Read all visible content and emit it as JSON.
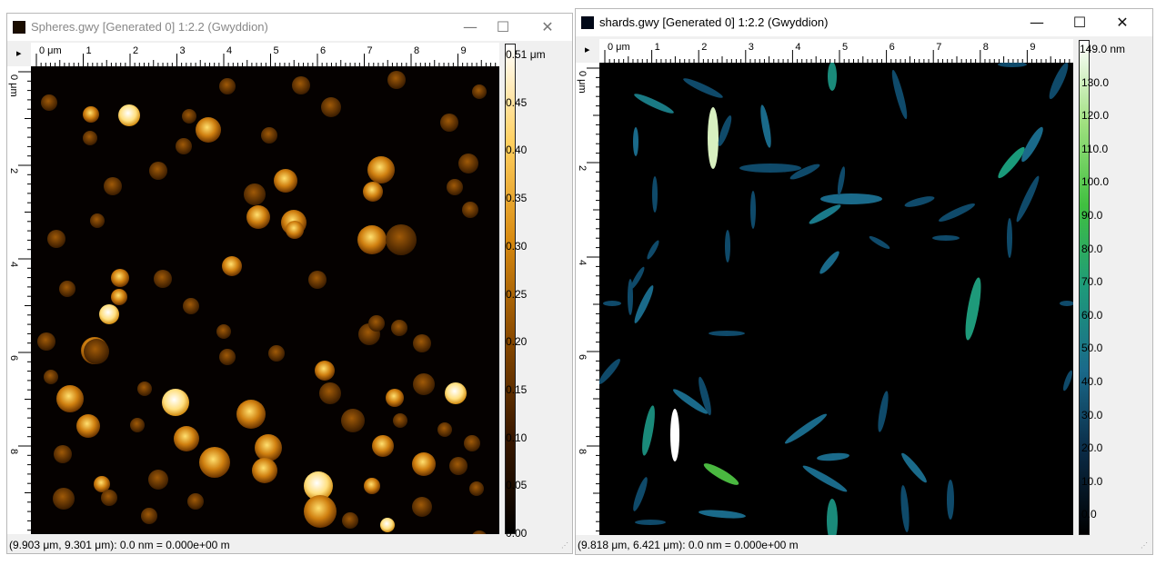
{
  "window1": {
    "title": "Spheres.gwy [Generated 0] 1:2.2 (Gwyddion)",
    "hruler_labels": [
      "0 μm",
      "1",
      "2",
      "3",
      "4",
      "5",
      "6",
      "7",
      "8",
      "9"
    ],
    "vruler_labels": [
      "0 μm",
      "2",
      "4",
      "6",
      "8"
    ],
    "colorbar": {
      "max_label": "0.51 μm",
      "ticks": [
        "0.45",
        "0.40",
        "0.35",
        "0.30",
        "0.25",
        "0.20",
        "0.15",
        "0.10",
        "0.05",
        "0.00"
      ],
      "gradient": [
        "#000000",
        "#3a1800",
        "#8a4a00",
        "#d88a10",
        "#ffd060",
        "#ffffff"
      ]
    },
    "status": "(9.903 μm, 9.301 μm): 0.0 nm = 0.000e+00 m"
  },
  "window2": {
    "title": "shards.gwy [Generated 0] 1:2.2 (Gwyddion)",
    "hruler_labels": [
      "0 μm",
      "1",
      "2",
      "3",
      "4",
      "5",
      "6",
      "7",
      "8",
      "9"
    ],
    "vruler_labels": [
      "0 μm",
      "2",
      "4",
      "6",
      "8"
    ],
    "colorbar": {
      "max_label": "149.0 nm",
      "ticks": [
        "130.0",
        "120.0",
        "110.0",
        "100.0",
        "90.0",
        "80.0",
        "70.0",
        "60.0",
        "50.0",
        "40.0",
        "30.0",
        "20.0",
        "10.0",
        "0.0"
      ],
      "gradient": [
        "#000000",
        "#0a2a45",
        "#1a6a8a",
        "#1e9a7a",
        "#40c040",
        "#a0e080",
        "#ffffff"
      ]
    },
    "status": "(9.818 μm, 6.421 μm): 0.0 nm = 0.000e+00 m"
  },
  "window_controls": {
    "minimize": "—",
    "maximize": "☐",
    "close": "✕"
  },
  "ruler_marker": "▸"
}
